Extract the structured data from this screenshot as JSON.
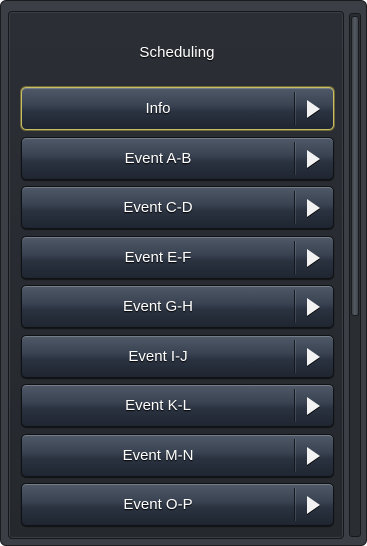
{
  "panel": {
    "title": "Scheduling"
  },
  "menu": {
    "items": [
      {
        "label": "Info",
        "selected": true
      },
      {
        "label": "Event A-B",
        "selected": false
      },
      {
        "label": "Event C-D",
        "selected": false
      },
      {
        "label": "Event E-F",
        "selected": false
      },
      {
        "label": "Event G-H",
        "selected": false
      },
      {
        "label": "Event I-J",
        "selected": false
      },
      {
        "label": "Event K-L",
        "selected": false
      },
      {
        "label": "Event M-N",
        "selected": false
      },
      {
        "label": "Event O-P",
        "selected": false
      }
    ],
    "item_icon": "chevron-right-icon"
  },
  "colors": {
    "selected_border": "#c9be67",
    "button_top": "#4f5968",
    "button_bottom": "#1f2631",
    "panel_bg": "#2b2f35"
  }
}
